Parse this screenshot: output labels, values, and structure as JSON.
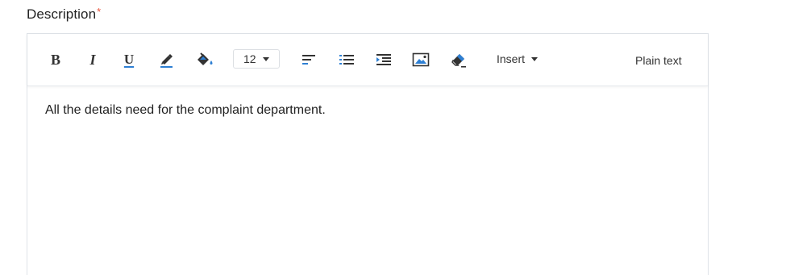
{
  "field": {
    "label": "Description",
    "required_marker": "*"
  },
  "toolbar": {
    "font_size": "12",
    "insert_label": "Insert",
    "plain_text_label": "Plain text",
    "icons": [
      "bold-icon",
      "italic-icon",
      "underline-icon",
      "text-color-icon",
      "highlight-color-icon",
      "align-left-icon",
      "bulleted-list-icon",
      "indent-icon",
      "image-icon",
      "clear-formatting-icon"
    ]
  },
  "editor": {
    "content": "All the details need for the complaint department."
  },
  "colors": {
    "accent_blue": "#2d7fd3",
    "required_star": "#e8553e",
    "border": "#dfe3e8"
  }
}
